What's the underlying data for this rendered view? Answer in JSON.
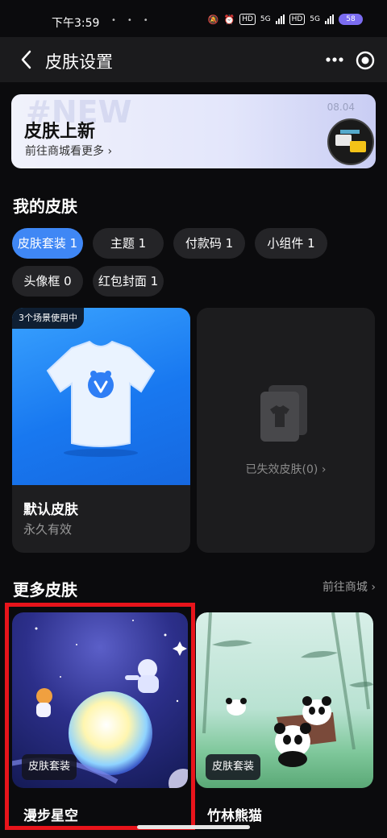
{
  "status_bar": {
    "time": "下午3:59",
    "network_labels": [
      "HD",
      "5G",
      "HD",
      "5G"
    ],
    "battery": "58"
  },
  "header": {
    "title": "皮肤设置"
  },
  "banner": {
    "watermark": "#NEW",
    "title": "皮肤上新",
    "subtitle": "前往商城看更多 ›",
    "date": "08.04"
  },
  "my_skins": {
    "heading": "我的皮肤",
    "chips": [
      {
        "label": "皮肤套装 1",
        "active": true
      },
      {
        "label": "主题 1",
        "active": false
      },
      {
        "label": "付款码 1",
        "active": false
      },
      {
        "label": "小组件 1",
        "active": false
      },
      {
        "label": "头像框 0",
        "active": false
      },
      {
        "label": "红包封面 1",
        "active": false
      }
    ],
    "default_card": {
      "usage_tag": "3个场景使用中",
      "name": "默认皮肤",
      "validity": "永久有效"
    },
    "expired_card": {
      "label": "已失效皮肤(0) ›"
    }
  },
  "more_skins": {
    "heading": "更多皮肤",
    "store_link": "前往商城 ›",
    "items": [
      {
        "badge": "皮肤套装",
        "name": "漫步星空"
      },
      {
        "badge": "皮肤套装",
        "name": "竹林熊猫"
      }
    ]
  }
}
